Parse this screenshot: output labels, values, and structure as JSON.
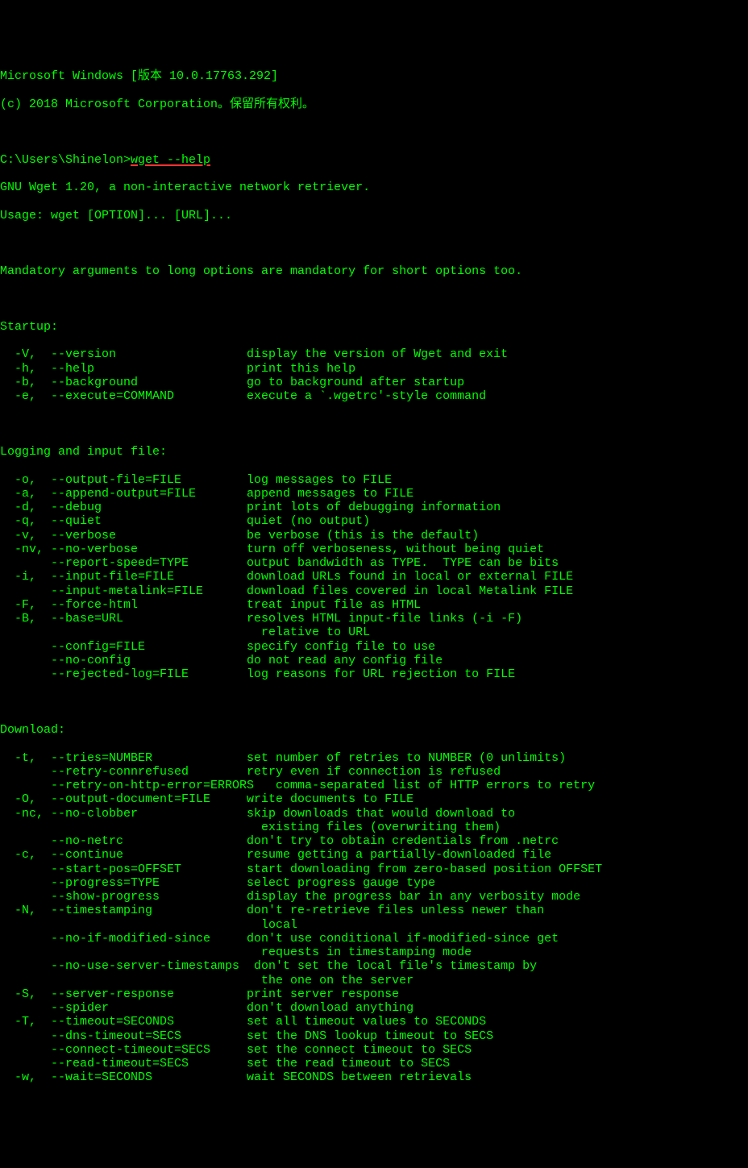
{
  "header": {
    "line1": "Microsoft Windows [版本 10.0.17763.292]",
    "line2": "(c) 2018 Microsoft Corporation。保留所有权利。"
  },
  "prompt": {
    "path": "C:\\Users\\Shinelon>",
    "command": "wget --help"
  },
  "intro": {
    "line1": "GNU Wget 1.20, a non-interactive network retriever.",
    "line2": "Usage: wget [OPTION]... [URL]...",
    "mandatory": "Mandatory arguments to long options are mandatory for short options too."
  },
  "sections": {
    "startup": {
      "title": "Startup:",
      "options": [
        {
          "flags": "  -V,  --version",
          "desc": "display the version of Wget and exit"
        },
        {
          "flags": "  -h,  --help",
          "desc": "print this help"
        },
        {
          "flags": "  -b,  --background",
          "desc": "go to background after startup"
        },
        {
          "flags": "  -e,  --execute=COMMAND",
          "desc": "execute a `.wgetrc'-style command"
        }
      ]
    },
    "logging": {
      "title": "Logging and input file:",
      "options": [
        {
          "flags": "  -o,  --output-file=FILE",
          "desc": "log messages to FILE"
        },
        {
          "flags": "  -a,  --append-output=FILE",
          "desc": "append messages to FILE"
        },
        {
          "flags": "  -d,  --debug",
          "desc": "print lots of debugging information"
        },
        {
          "flags": "  -q,  --quiet",
          "desc": "quiet (no output)"
        },
        {
          "flags": "  -v,  --verbose",
          "desc": "be verbose (this is the default)"
        },
        {
          "flags": "  -nv, --no-verbose",
          "desc": "turn off verboseness, without being quiet"
        },
        {
          "flags": "       --report-speed=TYPE",
          "desc": "output bandwidth as TYPE.  TYPE can be bits"
        },
        {
          "flags": "  -i,  --input-file=FILE",
          "desc": "download URLs found in local or external FILE"
        },
        {
          "flags": "       --input-metalink=FILE",
          "desc": "download files covered in local Metalink FILE"
        },
        {
          "flags": "  -F,  --force-html",
          "desc": "treat input file as HTML"
        },
        {
          "flags": "  -B,  --base=URL",
          "desc": "resolves HTML input-file links (-i -F)"
        },
        {
          "flags": "",
          "desc": "  relative to URL"
        },
        {
          "flags": "       --config=FILE",
          "desc": "specify config file to use"
        },
        {
          "flags": "       --no-config",
          "desc": "do not read any config file"
        },
        {
          "flags": "       --rejected-log=FILE",
          "desc": "log reasons for URL rejection to FILE"
        }
      ]
    },
    "download": {
      "title": "Download:",
      "options": [
        {
          "flags": "  -t,  --tries=NUMBER",
          "desc": "set number of retries to NUMBER (0 unlimits)"
        },
        {
          "flags": "       --retry-connrefused",
          "desc": "retry even if connection is refused"
        },
        {
          "flags": "       --retry-on-http-error=ERRORS",
          "desc": "comma-separated list of HTTP errors to retry",
          "compact": true
        },
        {
          "flags": "  -O,  --output-document=FILE",
          "desc": "write documents to FILE"
        },
        {
          "flags": "  -nc, --no-clobber",
          "desc": "skip downloads that would download to"
        },
        {
          "flags": "",
          "desc": "  existing files (overwriting them)"
        },
        {
          "flags": "       --no-netrc",
          "desc": "don't try to obtain credentials from .netrc"
        },
        {
          "flags": "  -c,  --continue",
          "desc": "resume getting a partially-downloaded file"
        },
        {
          "flags": "       --start-pos=OFFSET",
          "desc": "start downloading from zero-based position OFFSET"
        },
        {
          "flags": "       --progress=TYPE",
          "desc": "select progress gauge type"
        },
        {
          "flags": "       --show-progress",
          "desc": "display the progress bar in any verbosity mode"
        },
        {
          "flags": "  -N,  --timestamping",
          "desc": "don't re-retrieve files unless newer than"
        },
        {
          "flags": "",
          "desc": "  local"
        },
        {
          "flags": "       --no-if-modified-since",
          "desc": "don't use conditional if-modified-since get"
        },
        {
          "flags": "",
          "desc": "  requests in timestamping mode"
        },
        {
          "flags": "       --no-use-server-timestamps",
          "desc": "don't set the local file's timestamp by",
          "compact2": true
        },
        {
          "flags": "",
          "desc": "  the one on the server"
        },
        {
          "flags": "  -S,  --server-response",
          "desc": "print server response"
        },
        {
          "flags": "       --spider",
          "desc": "don't download anything"
        },
        {
          "flags": "  -T,  --timeout=SECONDS",
          "desc": "set all timeout values to SECONDS"
        },
        {
          "flags": "       --dns-timeout=SECS",
          "desc": "set the DNS lookup timeout to SECS"
        },
        {
          "flags": "       --connect-timeout=SECS",
          "desc": "set the connect timeout to SECS"
        },
        {
          "flags": "       --read-timeout=SECS",
          "desc": "set the read timeout to SECS"
        },
        {
          "flags": "  -w,  --wait=SECONDS",
          "desc": "wait SECONDS between retrievals"
        }
      ]
    }
  }
}
